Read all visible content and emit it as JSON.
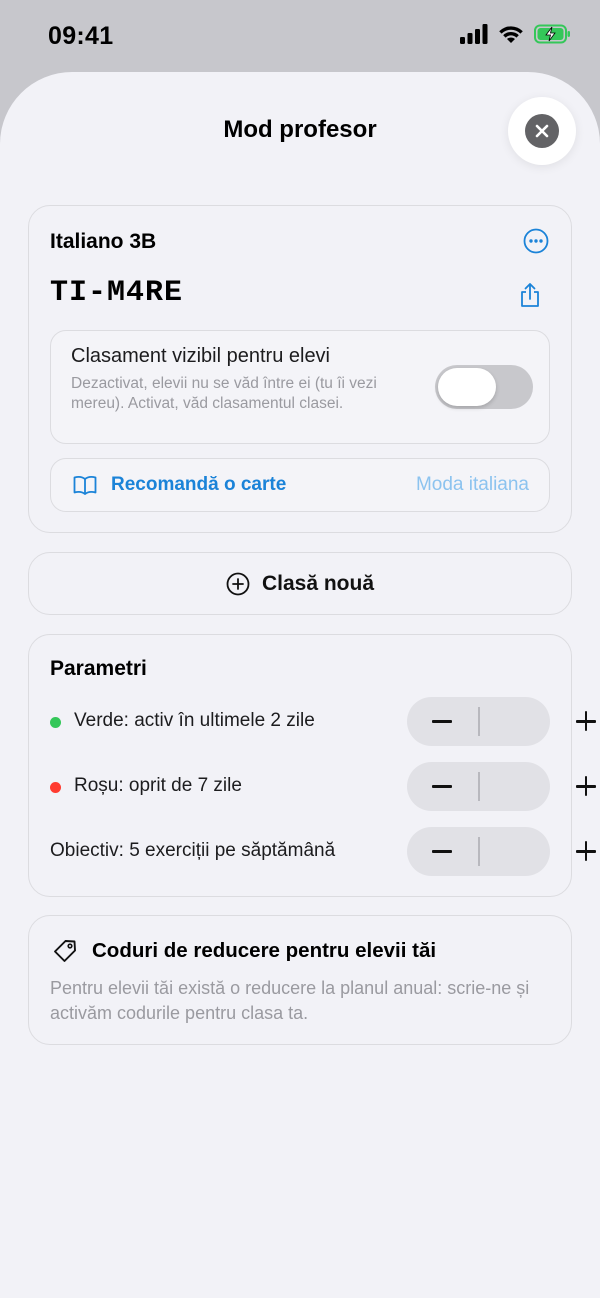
{
  "status_bar": {
    "time": "09:41"
  },
  "sheet": {
    "title": "Mod profesor"
  },
  "class_card": {
    "name": "Italiano 3B",
    "code": "TI-M4RE",
    "leaderboard": {
      "title": "Clasament vizibil pentru elevi",
      "description": "Dezactivat, elevii nu se văd între ei (tu îi vezi mereu). Activat, văd clasamentul clasei.",
      "enabled": false
    },
    "recommend": {
      "label": "Recomandă o carte",
      "value": "Moda italiana"
    }
  },
  "new_class": {
    "label": "Clasă nouă"
  },
  "parameters": {
    "title": "Parametri",
    "rows": [
      {
        "label": "Verde: activ în ultimele 2 zile",
        "dot_color": "#34c759"
      },
      {
        "label": "Roșu: oprit de 7 zile",
        "dot_color": "#ff3b30"
      },
      {
        "label": "Obiectiv: 5 exerciții pe săptămână"
      }
    ]
  },
  "discount": {
    "title": "Coduri de reducere pentru elevii tăi",
    "description": "Pentru elevii tăi există o reducere la planul anual: scrie-ne și activăm codurile pentru clasa ta."
  },
  "colors": {
    "accent": "#1b83d8",
    "accent_light": "#8cc3ef",
    "green": "#34c759",
    "red": "#ff3b30"
  },
  "icons": [
    "ellipsis-circle-icon",
    "share-icon",
    "book-icon",
    "plus-circle-icon",
    "tag-icon",
    "close-icon"
  ]
}
